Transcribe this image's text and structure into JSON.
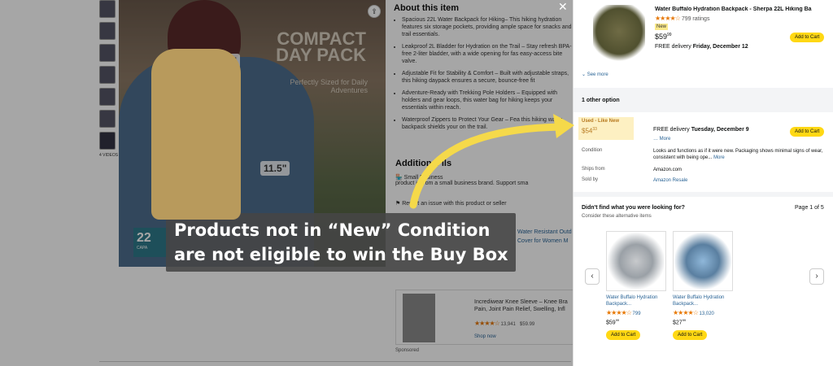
{
  "background": {
    "hero_title": "COMPACT DAY PACK",
    "hero_tagline": "Perfectly Sized for Daily Adventures",
    "dim_height": "15\"",
    "dim_width": "11.5\"",
    "capacity_badge": "22",
    "capacity_unit": "CAPA",
    "video_label": "4 VIDEOS",
    "about_heading": "About this item",
    "bullets": [
      "Spacious 22L Water Backpack for Hiking– This hiking hydration features six storage pockets, providing ample space for snacks and trail essentials.",
      "Leakproof 2L Bladder for Hydration on the Trail – Stay refresh BPA-free 2-liter bladder, with a wide opening for fas easy-access bite valve.",
      "Adjustable Fit for Stability & Comfort – Built with adjustable straps, this hiking daypack ensures a secure, bounce-free fit",
      "Adventure-Ready with Trekking Pole Holders – Equipped with holders and gear loops, this water bag for hiking keeps your essentials within reach.",
      "Waterproof Zippers to Protect Your Gear – Fea this hiking water backpack shields your on the trail."
    ],
    "additional_heading": "Additional     ils",
    "small_biz": "Small Business",
    "small_biz_desc": "product is from a small business brand. Support sma",
    "report": "Report an issue with this product or seller",
    "side_link1": "Water Resistant Outd",
    "side_link2": "Cover for Women M",
    "sponsored_title": "Incrediwear Knee Sleeve – Knee Bra Pain, Joint Pain Relief, Swelling, Infl",
    "sponsored_reviews": "13,941",
    "sponsored_price": "$59.99",
    "sponsored_shop": "Shop now",
    "sponsored_label": "Sponsored"
  },
  "panel": {
    "title": "Water Buffalo Hydration Backpack - Sherpa 22L Hiking Ba",
    "rating_count": "799 ratings",
    "badge": "New",
    "price_whole": "$59",
    "price_frac": "99",
    "delivery_prefix": "FREE delivery",
    "delivery_date": "Friday, December 12",
    "add_to_cart": "Add to Cart",
    "see_more": "See more",
    "other_option": "1 other option",
    "used_label": "Used - Like New",
    "used_price_whole": "$54",
    "used_price_frac": "33",
    "used_delivery_prefix": "FREE delivery",
    "used_delivery_date": "Tuesday, December 9",
    "more": "More",
    "condition_label": "Condition",
    "condition_value": "Looks and functions as if it were new. Packaging shows minimal signs of wear, consistent with being ope...",
    "condition_more": "More",
    "ships_label": "Ships from",
    "ships_value": "Amazon.com",
    "sold_label": "Sold by",
    "sold_value": "Amazon Resale",
    "didnt_find": "Didn't find what you were looking for?",
    "consider": "Consider these alternative items",
    "page_of": "Page 1 of 5",
    "alt_items": [
      {
        "name": "Water Buffalo Hydration Backpack...",
        "reviews": "799",
        "price_whole": "$59",
        "price_frac": "99"
      },
      {
        "name": "Water Buffalo Hydration Backpack...",
        "reviews": "13,020",
        "price_whole": "$27",
        "price_frac": "99"
      }
    ]
  },
  "caption": {
    "line1": "Products not in “New” Condition",
    "line2": "are not eligible to win the Buy Box"
  },
  "colors": {
    "arrow": "#f5d94a",
    "cart_button": "#ffd814",
    "used_highlight": "#fdf0c2",
    "star": "#e77600",
    "link": "#2a6496"
  },
  "icons": [
    "close-icon",
    "share-icon",
    "chevron-left-icon",
    "chevron-right-icon",
    "small-business-icon",
    "report-icon"
  ]
}
